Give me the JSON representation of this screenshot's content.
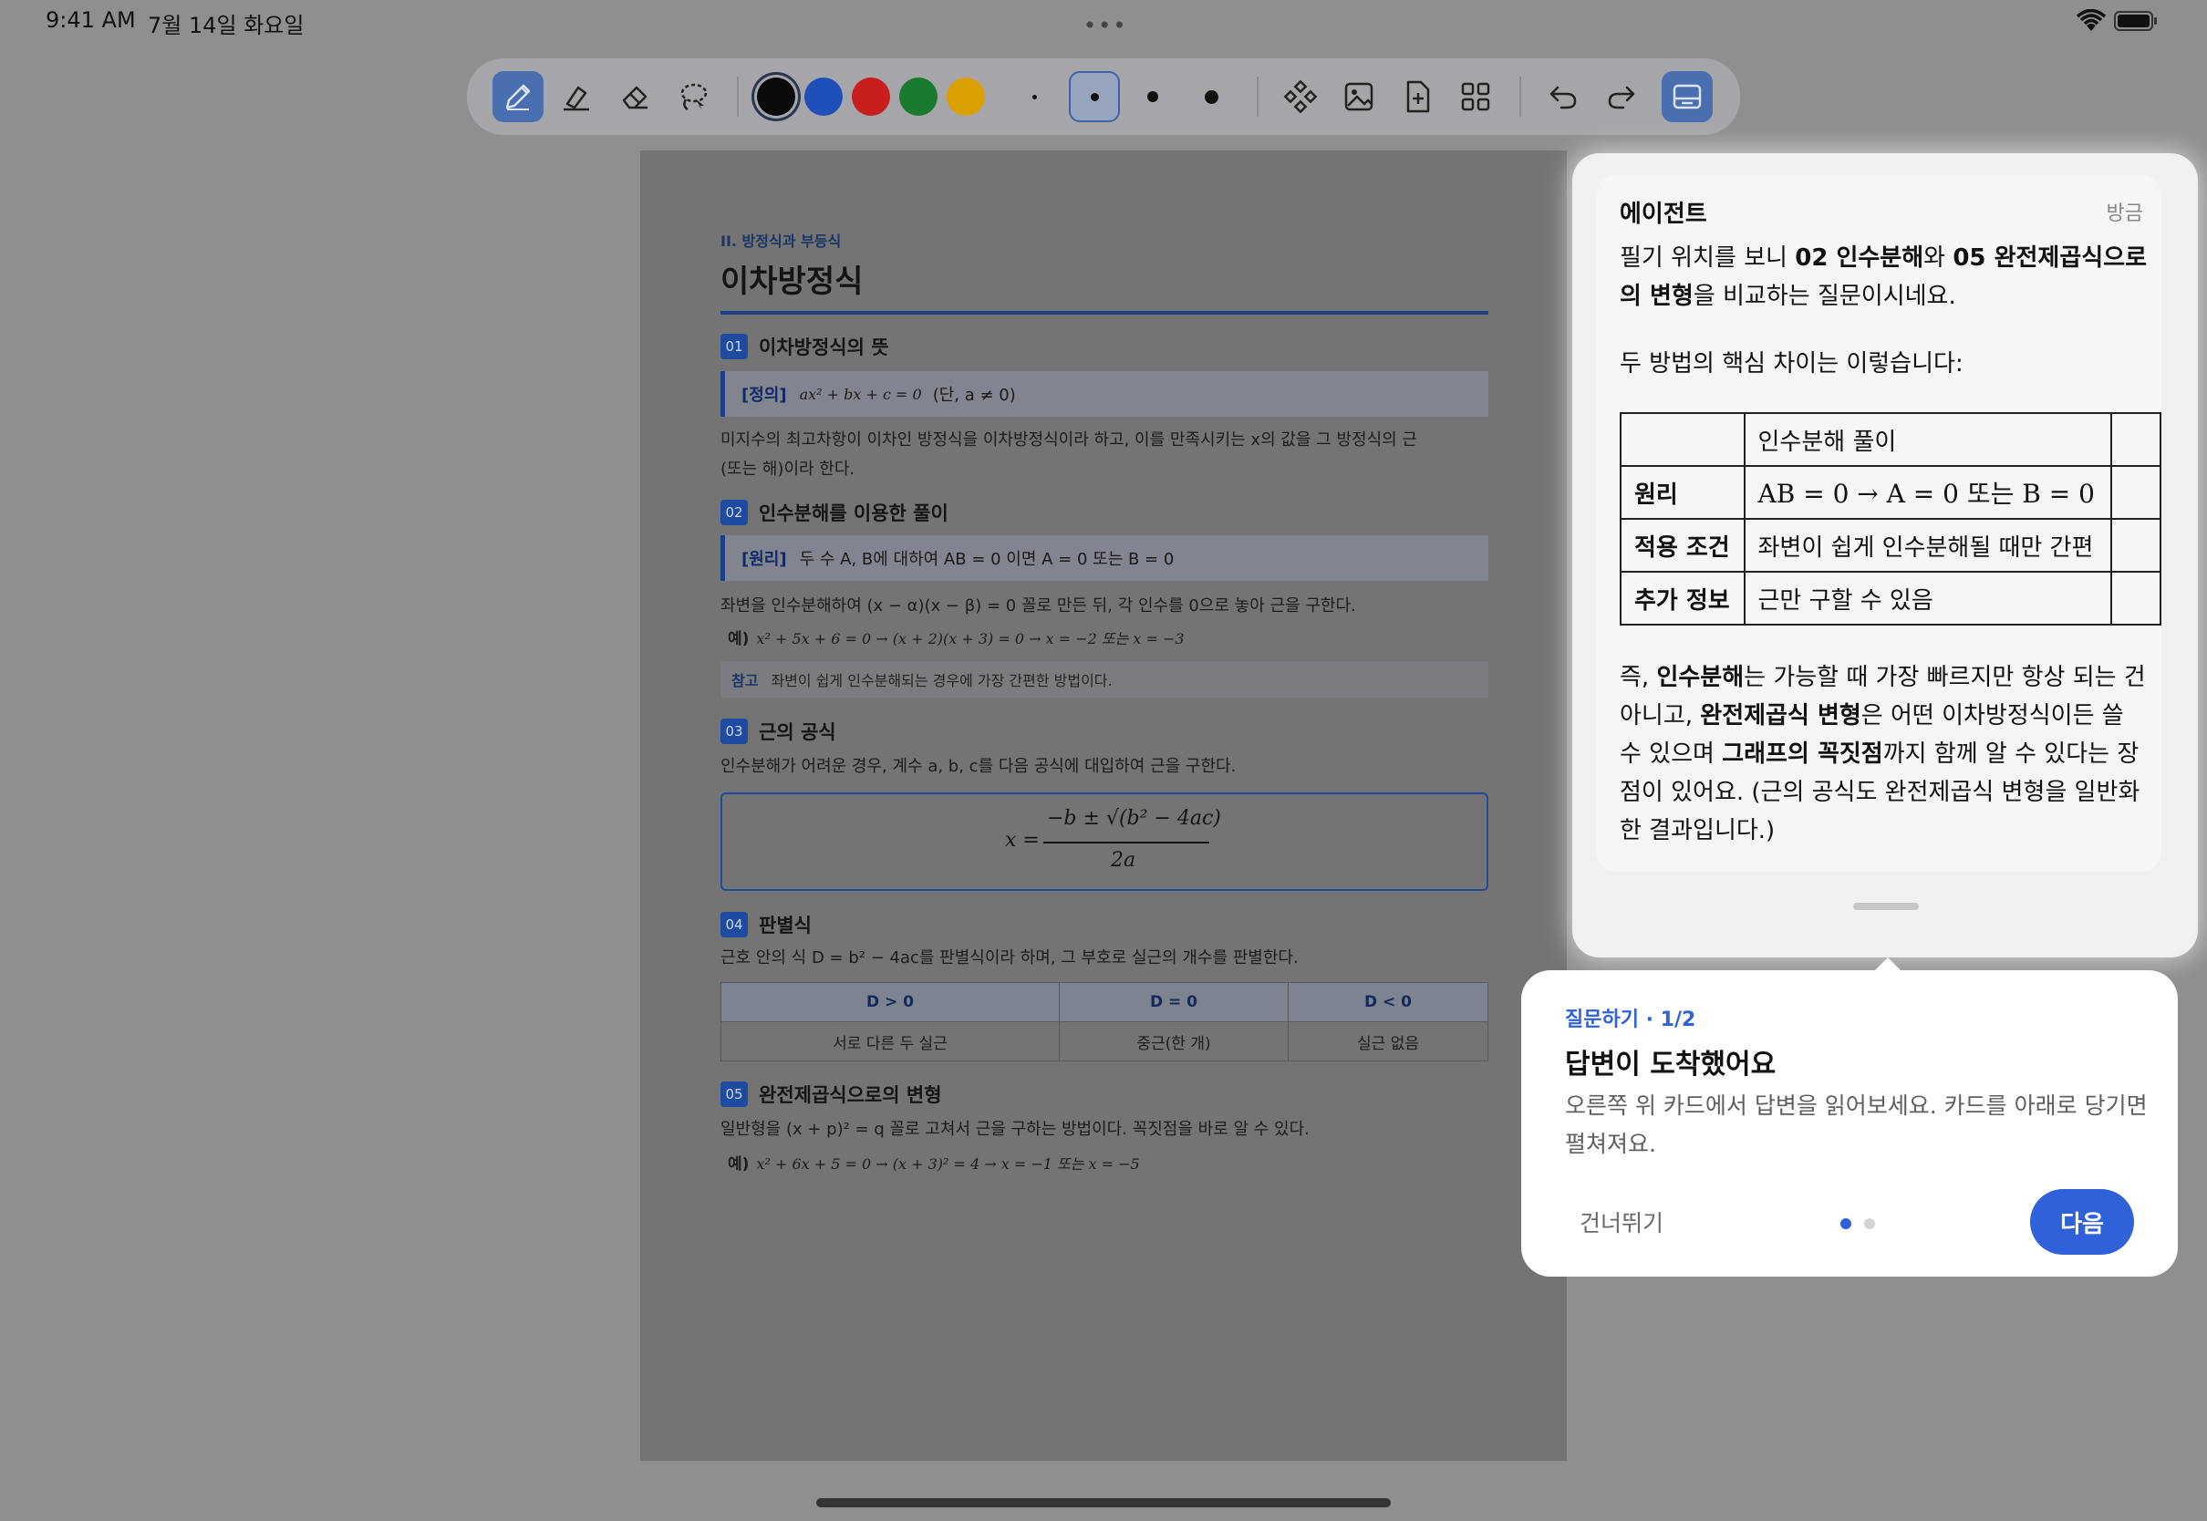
{
  "status": {
    "time": "9:41 AM",
    "date": "7월 14일 화요일"
  },
  "toolbar": {
    "colors": [
      "#0a0a0a",
      "#1f4fb8",
      "#c81e1e",
      "#1a7a2e",
      "#d9a000"
    ],
    "selected_color": "#0a0a0a"
  },
  "document": {
    "chapter": "II. 방정식과 부등식",
    "title": "이차방정식",
    "s1": {
      "no": "01",
      "title": "이차방정식의 뜻",
      "callout_tag": "[정의]",
      "callout_math": "ax² + bx + c = 0",
      "callout_text": "(단, a ≠ 0)",
      "body1": "미지수의 최고차항이 이차인 방정식을 이차방정식이라 하고, 이를 만족시키는 x의 값을 그 방정식의 근",
      "body2": "(또는 해)이라 한다."
    },
    "s2": {
      "no": "02",
      "title": "인수분해를 이용한 풀이",
      "callout_tag": "[원리]",
      "callout_text": "두 수 A, B에 대하여  AB = 0  이면  A = 0 또는 B = 0",
      "body": "좌변을 인수분해하여 (x − α)(x − β) = 0 꼴로 만든 뒤, 각 인수를 0으로 놓아 근을 구한다.",
      "example_tag": "예)",
      "example": "x² + 5x + 6 = 0 → (x + 2)(x + 3) = 0 → x = −2 또는 x = −3",
      "note_tag": "참고",
      "note": "좌변이 쉽게 인수분해되는 경우에 가장 간편한 방법이다."
    },
    "s3": {
      "no": "03",
      "title": "근의 공식",
      "body": "인수분해가 어려운 경우, 계수 a, b, c를 다음 공식에 대입하여 근을 구한다.",
      "fx": "x =",
      "fnum": "−b ± √(b² − 4ac)",
      "fden": "2a"
    },
    "s4": {
      "no": "04",
      "title": "판별식",
      "body": "근호 안의 식 D = b² − 4ac를 판별식이라 하며, 그 부호로 실근의 개수를 판별한다.",
      "headers": [
        "D > 0",
        "D = 0",
        "D < 0"
      ],
      "cells": [
        "서로 다른 두 실근",
        "중근(한 개)",
        "실근 없음"
      ]
    },
    "s5": {
      "no": "05",
      "title": "완전제곱식으로의 변형",
      "body": "일반형을 (x + p)² = q 꼴로 고쳐서 근을 구하는 방법이다. 꼭짓점을 바로 알 수 있다.",
      "example_tag": "예)",
      "example": "x² + 6x + 5 = 0 → (x + 3)² = 4 → x = −1 또는 x = −5"
    }
  },
  "agent": {
    "name": "에이전트",
    "time": "방금",
    "intro_a": "필기 위치를 보니 ",
    "intro_b1": "02 인수분해",
    "intro_c": "와 ",
    "intro_b2": "05 완전제곱식으",
    "intro_b3": "로의 변형",
    "intro_d": "을 비교하는 질문이시네요.",
    "lead": "두 방법의 핵심 차이는 이렇습니다:",
    "table": {
      "col_header": "인수분해 풀이",
      "rows": [
        {
          "label": "원리",
          "value": "AB = 0 → A = 0 또는 B = 0"
        },
        {
          "label": "적용 조건",
          "value": "좌변이 쉽게 인수분해될 때만 간편"
        },
        {
          "label": "추가 정보",
          "value": "근만 구할 수 있음"
        }
      ]
    },
    "outro_1": "즉, ",
    "outro_b1": "인수분해",
    "outro_2": "는 가능할 때 가장 빠르지만 항상 되는 건 아니고, ",
    "outro_b2": "완전제곱식 변형",
    "outro_3": "은 어떤 이차방정식이든 쓸 수 있으며 ",
    "outro_b3": "그래프의 꼭짓점",
    "outro_4": "까지 함께 알 수 있다는 장점이 있어요. (근의 공식도 완전제곱식 변형을 일반화한 결과입니다.)"
  },
  "coach": {
    "step": "질문하기 · 1/2",
    "title": "답변이 도착했어요",
    "desc": "오른쪽 위 카드에서 답변을 읽어보세요. 카드를 아래로 당기면 펼쳐져요.",
    "skip": "건너뛰기",
    "next": "다음",
    "page_index": 1,
    "page_count": 2,
    "accent": "#2f62d8"
  }
}
